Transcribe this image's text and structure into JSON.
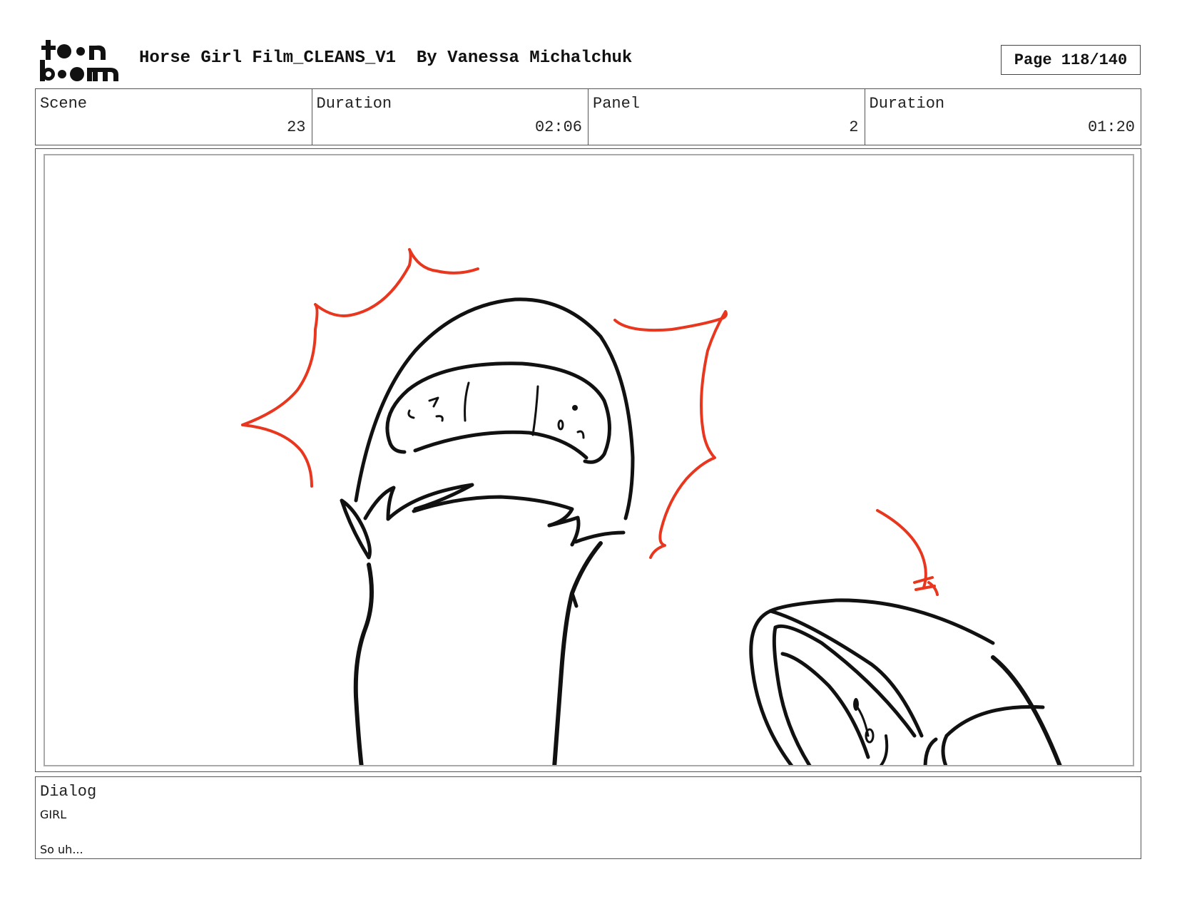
{
  "header": {
    "logo_text": "toon boom",
    "title": "Horse Girl Film_CLEANS_V1  By Vanessa Michalchuk",
    "page": "Page 118/140"
  },
  "info": [
    {
      "label": "Scene",
      "value": "23"
    },
    {
      "label": "Duration",
      "value": "02:06"
    },
    {
      "label": "Panel",
      "value": "2"
    },
    {
      "label": "Duration",
      "value": "01:20"
    }
  ],
  "panel": {
    "line_color": "#111111",
    "accent_color": "#e8371e"
  },
  "dialog": {
    "label": "Dialog",
    "speaker": "GIRL",
    "line": "So uh..."
  }
}
